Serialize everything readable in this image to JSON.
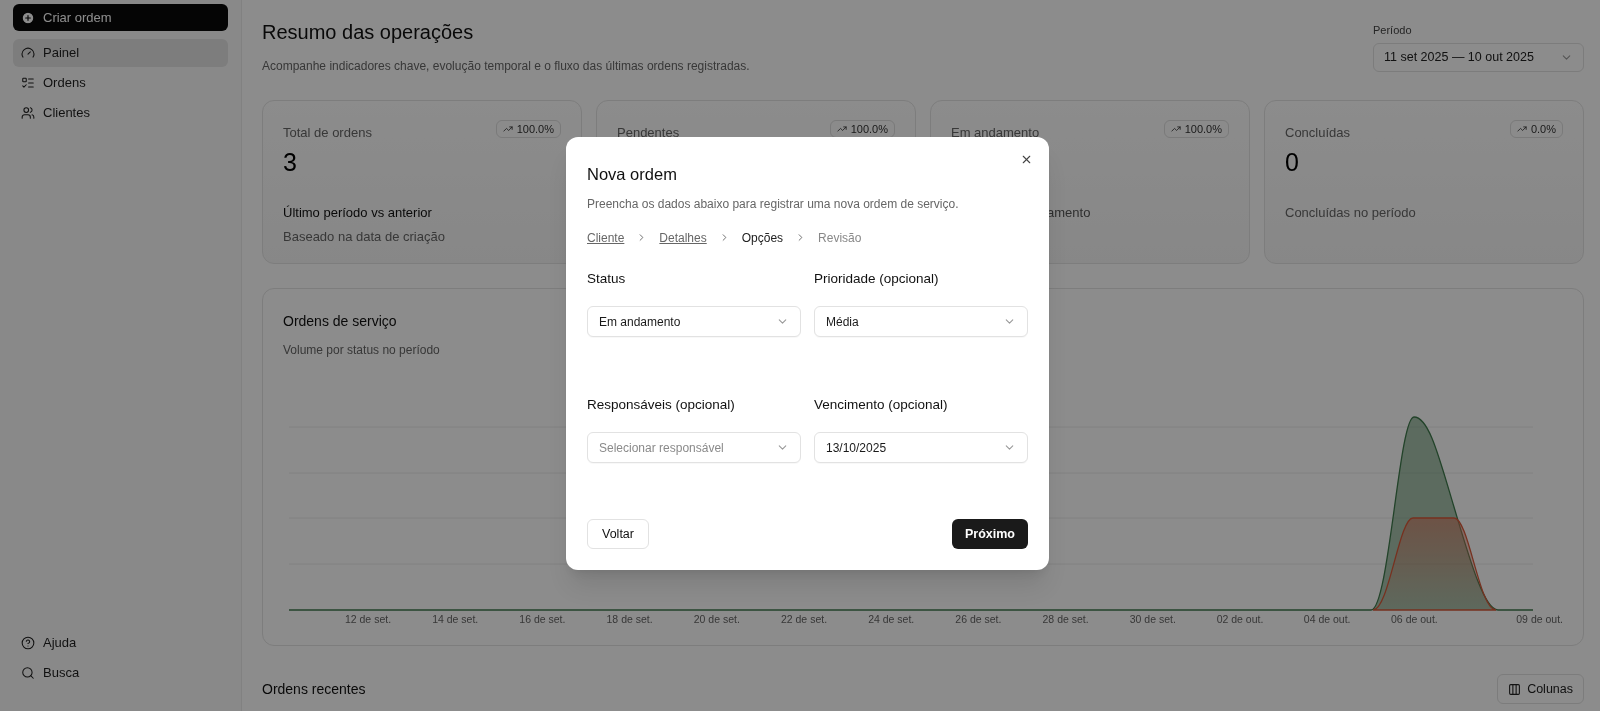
{
  "sidebar": {
    "primary_action": "Criar ordem",
    "items": [
      {
        "label": "Painel",
        "selected": true
      },
      {
        "label": "Ordens",
        "selected": false
      },
      {
        "label": "Clientes",
        "selected": false
      }
    ],
    "footer_items": [
      {
        "label": "Ajuda"
      },
      {
        "label": "Busca"
      }
    ]
  },
  "header": {
    "title": "Resumo das operações",
    "subtitle": "Acompanhe indicadores chave, evolução temporal e o fluxo das últimas ordens registradas.",
    "period": {
      "label": "Período",
      "value": "11 set 2025 — 10 out 2025"
    }
  },
  "stat_cards": [
    {
      "label": "Total de ordens",
      "badge": "100.0%",
      "value": "3",
      "lines": [
        {
          "text": "Último período vs anterior",
          "kind": "strong"
        },
        {
          "text": "Baseado na data de criação",
          "kind": "muted"
        }
      ]
    },
    {
      "label": "Pendentes",
      "badge": "100.0%"
    },
    {
      "label": "Em andamento",
      "badge": "100.0%",
      "lines": [
        {
          "text": "amento",
          "kind": "clipped"
        }
      ]
    },
    {
      "label": "Concluídas",
      "badge": "0.0%",
      "value": "0",
      "lines": [
        {
          "text": "Concluídas no período",
          "kind": "muted"
        }
      ]
    }
  ],
  "chart": {
    "title": "Ordens de serviço",
    "subtitle": "Volume por status no período",
    "x_labels": [
      "12 de set.",
      "14 de set.",
      "16 de set.",
      "18 de set.",
      "20 de set.",
      "22 de set.",
      "24 de set.",
      "26 de set.",
      "28 de set.",
      "30 de set.",
      "02 de out.",
      "04 de out.",
      "06 de out.",
      "09 de out."
    ]
  },
  "recent": {
    "title": "Ordens recentes",
    "columns_button": "Colunas"
  },
  "modal": {
    "title": "Nova ordem",
    "description": "Preencha os dados abaixo para registrar uma nova ordem de serviço.",
    "steps": [
      {
        "label": "Cliente",
        "done": true,
        "selected": false
      },
      {
        "label": "Detalhes",
        "done": true,
        "selected": false
      },
      {
        "label": "Opções",
        "done": false,
        "selected": true
      },
      {
        "label": "Revisão",
        "done": false,
        "selected": false
      }
    ],
    "fields": [
      {
        "label": "Status",
        "value": "Em andamento"
      },
      {
        "label": "Prioridade (opcional)",
        "value": "Média"
      },
      {
        "label": "Responsáveis (opcional)",
        "placeholder": "Selecionar responsável"
      },
      {
        "label": "Vencimento (opcional)",
        "value": "13/10/2025"
      }
    ],
    "back_button": "Voltar",
    "next_button": "Próximo"
  }
}
